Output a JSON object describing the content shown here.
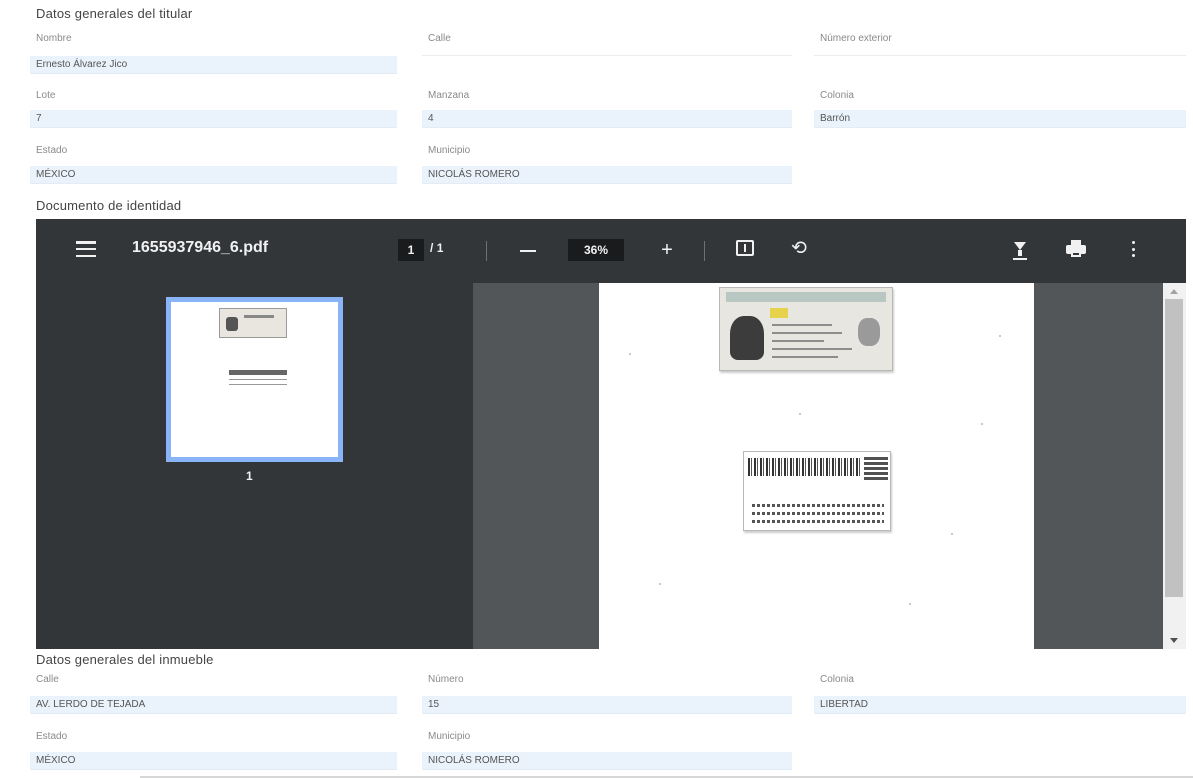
{
  "titular": {
    "title": "Datos generales del titular",
    "nombre_label": "Nombre",
    "nombre_value": "Ernesto Álvarez Jico",
    "calle_label": "Calle",
    "calle_value": "",
    "numero_ext_label": "Número exterior",
    "numero_ext_value": "",
    "lote_label": "Lote",
    "lote_value": "7",
    "manzana_label": "Manzana",
    "manzana_value": "4",
    "colonia_label": "Colonia",
    "colonia_value": "Barrón",
    "estado_label": "Estado",
    "estado_value": "MÉXICO",
    "municipio_label": "Municipio",
    "municipio_value": "NICOLÁS ROMERO"
  },
  "documento": {
    "title": "Documento de identidad"
  },
  "pdf_viewer": {
    "file_name": "1655937946_6.pdf",
    "current_page": "1",
    "page_separator": "/",
    "total_pages": "1",
    "zoom": "36%",
    "zoom_in_symbol": "+",
    "rotate_symbol": "⟲",
    "thumbnail_page_number": "1",
    "icons": [
      "menu-icon",
      "zoom-out-icon",
      "zoom-in-icon",
      "fit-to-page-icon",
      "rotate-icon",
      "download-icon",
      "print-icon",
      "more-options-icon"
    ],
    "colors": {
      "toolbar": "#323639",
      "viewer_bg": "#525659",
      "thumbnail_selected": "#8ab4f8"
    }
  },
  "inmueble": {
    "title": "Datos generales del inmueble",
    "calle_label": "Calle",
    "calle_value": "AV. LERDO DE TEJADA",
    "numero_label": "Número",
    "numero_value": "15",
    "colonia_label": "Colonia",
    "colonia_value": "LIBERTAD",
    "estado_label": "Estado",
    "estado_value": "MÉXICO",
    "municipio_label": "Municipio",
    "municipio_value": "NICOLÁS ROMERO"
  }
}
